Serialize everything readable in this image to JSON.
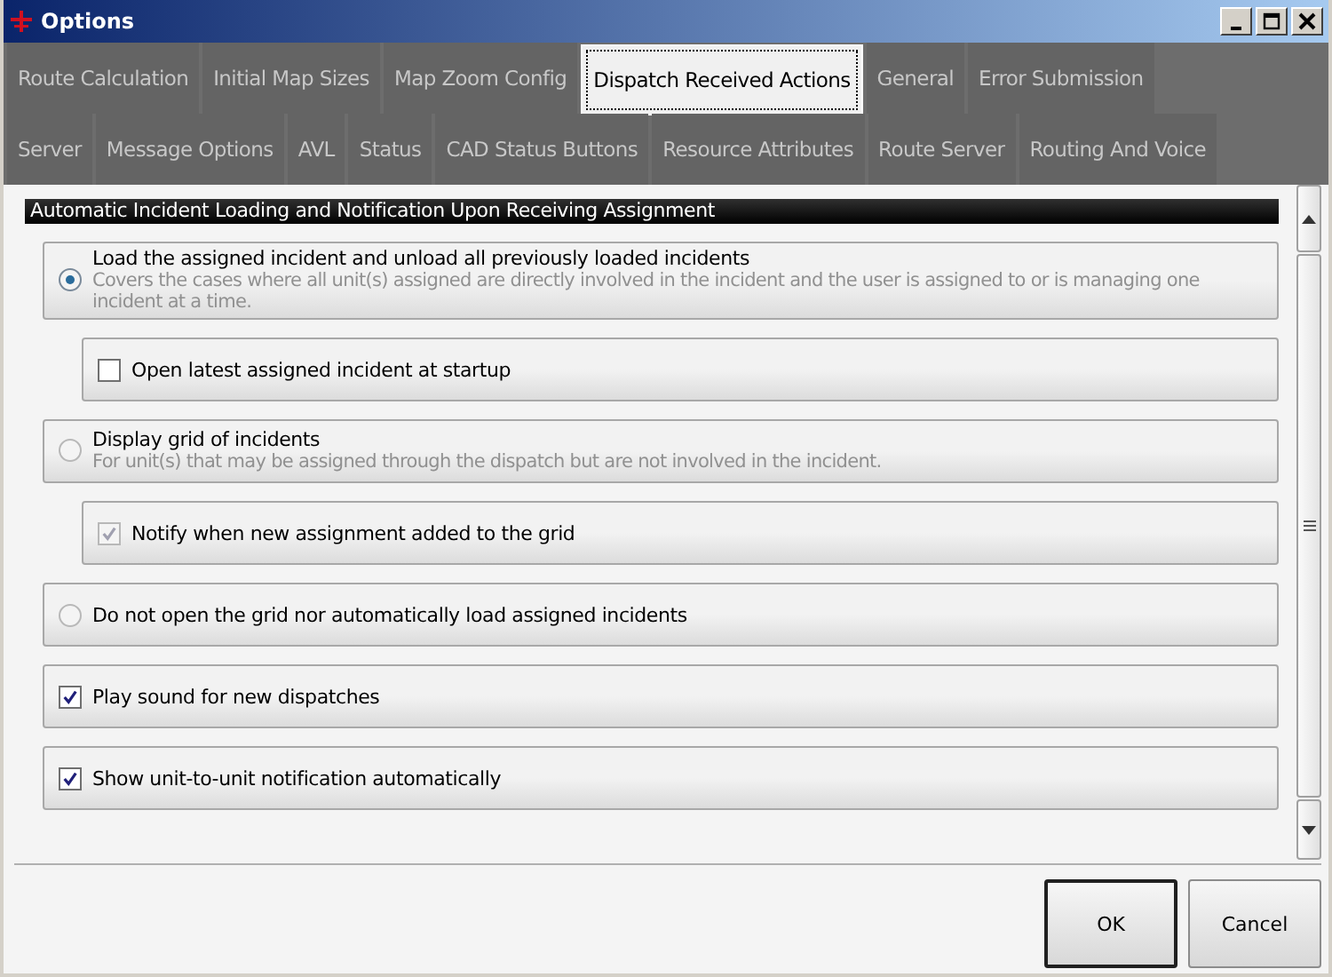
{
  "window": {
    "title": "Options"
  },
  "tab_rows": [
    [
      {
        "label": "Route Calculation",
        "selected": false
      },
      {
        "label": "Initial Map Sizes",
        "selected": false
      },
      {
        "label": "Map Zoom Config",
        "selected": false
      },
      {
        "label": "Dispatch Received Actions",
        "selected": true
      },
      {
        "label": "General",
        "selected": false
      },
      {
        "label": "Error Submission",
        "selected": false
      }
    ],
    [
      {
        "label": "Server",
        "selected": false
      },
      {
        "label": "Message Options",
        "selected": false
      },
      {
        "label": "AVL",
        "selected": false
      },
      {
        "label": "Status",
        "selected": false
      },
      {
        "label": "CAD Status Buttons",
        "selected": false
      },
      {
        "label": "Resource Attributes",
        "selected": false
      },
      {
        "label": "Route Server",
        "selected": false
      },
      {
        "label": "Routing And Voice",
        "selected": false
      }
    ]
  ],
  "section": {
    "title": "Automatic Incident Loading and Notification Upon Receiving Assignment"
  },
  "options": [
    {
      "kind": "radio",
      "label": "Load the assigned incident and unload all previously loaded incidents",
      "description": "Covers the cases where all unit(s) assigned are directly involved in the incident and the user is assigned to or is managing one incident at a time.",
      "selected": true,
      "children": [
        {
          "kind": "checkbox",
          "label": "Open latest assigned incident at startup",
          "checked": false,
          "disabled": false
        }
      ]
    },
    {
      "kind": "radio",
      "label": "Display grid of incidents",
      "description": "For unit(s) that may be assigned through the dispatch but are not involved in the incident.",
      "selected": false,
      "children": [
        {
          "kind": "checkbox",
          "label": "Notify when new assignment added to the grid",
          "checked": true,
          "disabled": true
        }
      ]
    },
    {
      "kind": "radio",
      "label": "Do not open the grid nor automatically load assigned incidents",
      "selected": false
    },
    {
      "kind": "checkbox",
      "label": "Play sound for new dispatches",
      "checked": true,
      "disabled": false
    },
    {
      "kind": "checkbox",
      "label": "Show unit-to-unit notification automatically",
      "checked": true,
      "disabled": false
    }
  ],
  "buttons": [
    {
      "label": "OK",
      "default": true
    },
    {
      "label": "Cancel",
      "default": false
    }
  ]
}
